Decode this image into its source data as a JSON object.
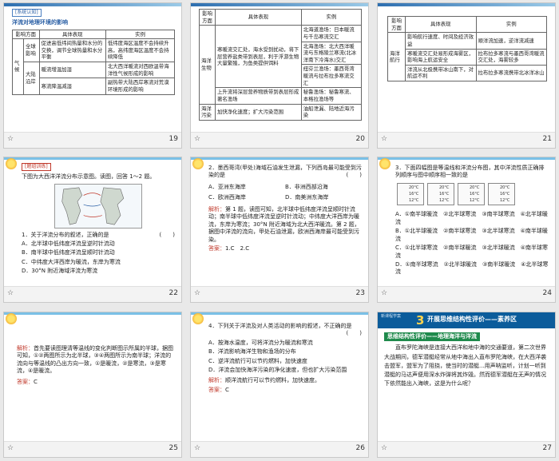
{
  "slides": [
    {
      "num": "19",
      "tag": "[系统认知]",
      "title": "洋流对地理环境的影响",
      "headers": [
        "影响方面",
        "具体表现",
        "实例"
      ],
      "rows": [
        {
          "c0": "气候",
          "c1": "全球影响",
          "c2": "促进高低纬间热量和水分的交换，调节全球热量和水分平衡",
          "c3": "低纬度海区温度不会持续升高，高纬度海区温度不会持续降低"
        },
        {
          "c0": "",
          "c1": "大陆沿岸",
          "c2": "暖流增温加湿",
          "c3": "北大西洋暖流对西欧温带海洋性气候形成的影响"
        },
        {
          "c0": "",
          "c1": "",
          "c2": "寒流降温减湿",
          "c3": "副热带大陆西岸寒流对荒漠环境形成的影响"
        }
      ]
    },
    {
      "num": "20",
      "headers": [
        "影响方面",
        "具体表现",
        "实例"
      ],
      "rows": [
        {
          "c0": "海洋生物",
          "c1": "寒暖流交汇处，海水受到扰动，将下层营养盐类带到表层，利于浮游生物大量繁殖，为鱼类提供饵料",
          "c2": "北海道渔场：日本暖流与千岛寒流交汇"
        },
        {
          "c0": "",
          "c1": "",
          "c2": "北海渔场：北大西洋暖流与东格陵兰寒流(北冰洋南下冷海水)交汇"
        },
        {
          "c0": "",
          "c1": "",
          "c2": "纽芬兰渔场：墨西哥湾暖流与拉布拉多寒流交汇"
        },
        {
          "c0": "",
          "c1": "上升流将深层营养物质带到表层形成著名渔场",
          "c2": "秘鲁渔场：秘鲁寒流、本格拉渔场等"
        },
        {
          "c0": "海洋污染",
          "c1": "加快净化速度；扩大污染范围",
          "c2": "油船泄漏、陆地近海污染"
        }
      ]
    },
    {
      "num": "21",
      "headers": [
        "影响方面",
        "具体表现",
        "实例"
      ],
      "rows": [
        {
          "c0": "海洋航行",
          "c1": "影响航行速度、时间及经济效益",
          "c2": "顺洋流加速，逆洋流减速"
        },
        {
          "c0": "",
          "c1": "寒暖流交汇处易形成海雾区，影响海上航运安全",
          "c2": "拉布拉多寒流与墨西哥湾暖流交汇处，海雾较多"
        },
        {
          "c0": "",
          "c1": "洋流从北极携带冰山南下，对航运不利",
          "c2": "拉布拉多寒流携带北冰洋冰山"
        }
      ]
    },
    {
      "num": "22",
      "tag": "[题组训练]",
      "intro": "下图为大西洋洋流分布示意图。读图，回答 1～2 题。",
      "question": "1．关于洋流分布的叙述，正确的是",
      "paren": "(　　)",
      "options": [
        "A．北半球中低纬度洋流呈逆时针流动",
        "B．南半球中低纬度洋流呈顺时针流动",
        "C．中纬度大洋西岸为暖流，东岸为寒流",
        "D．30°N 附近海域洋流为寒流"
      ]
    },
    {
      "num": "23",
      "question": "2．墨西哥湾(甲处)海域石油发生泄漏，下列西岛最可能受到污染的是",
      "paren": "(　　)",
      "options": [
        "A．亚洲东海岸",
        "B．非洲西部沿海",
        "C．欧洲西海岸",
        "D．南美洲东海岸"
      ],
      "analysis_label": "解析：",
      "analysis": "第 1 题，读图可知，北半球中低纬度洋流呈顺时针流动；南半球中低纬度洋流呈逆时针流动；中纬度大洋西岸为暖流，东岸为寒流；30°N 附近海域为北大西洋暖流。第 2 题，据图中洋流的流向，甲处石油泄漏，欧洲西海岸最可能受到污染。",
      "answer_label": "答案：",
      "answer": "1.C　2.C"
    },
    {
      "num": "24",
      "question": "3．下面四幅图是等温线和洋流分布图，其中洋流性质正确排列顺序与图中顺序相一致的是",
      "temps": [
        [
          "20°C",
          "16°C",
          "12°C"
        ],
        [
          "20°C",
          "16°C",
          "12°C"
        ],
        [
          "20°C",
          "16°C",
          "12°C"
        ],
        [
          "20°C",
          "16°C",
          "12°C"
        ]
      ],
      "options": [
        "A．①南半球暖流　②北半球寒流　③南半球寒流　④北半球暖流",
        "B．①北半球暖流　②南半球寒流　③北半球寒流　④南半球暖流",
        "C．①北半球寒流　②南半球暖流　③北半球暖流　④南半球寒流",
        "D．①南半球寒流　②北半球暖流　③南半球暖流　④北半球寒流"
      ]
    },
    {
      "num": "25",
      "analysis_label": "解析：",
      "analysis": "首先要读图理清等温线的变化判断图示所属的半球，据图可知，①②两图所示为北半球，③④两图所示为南半球；洋流的流向与等温线的凸出方向一致，①是暖流，②是寒流，③是寒流，④是暖流。",
      "answer_label": "答案：",
      "answer": "C"
    },
    {
      "num": "26",
      "question": "4．下列关于洋流及对人类活动的影响的叙述，不正确的是",
      "paren": "(　　)",
      "options": [
        "A．按海水温度，可将洋流分为暖流和寒流",
        "B．洋流影响海洋生物和渔场的分布",
        "C．逆洋流航行可以节约燃料，加快速度",
        "D．洋流会加快海洋污染的净化速度，但也扩大污染范围"
      ],
      "analysis_label": "解析：",
      "analysis": "顺洋流航行可以节约燃料，加快速度。",
      "answer_label": "答案：",
      "answer": "C"
    },
    {
      "num": "27",
      "header_small": "新课程学案",
      "header_num": "3",
      "header_title": "开展思维结构性评价——素养区",
      "section": "思维结构性评价——地理海洋与洋流",
      "body": "直布罗陀海峡是连接大西洋和地中海的交通要道，第二次世界大战期间，德军潜艇经常从地中海出入直布罗陀海峡，在大西洋袭击盟军，盟军为了阻挠，使当时的潜艇...用声呐监听，计划一听到潜艇的马达声便用深水炸弹将其炸毁。然而德军潜艇在无声的情况下依然能出入海峡，这是为什么呢？"
    }
  ]
}
